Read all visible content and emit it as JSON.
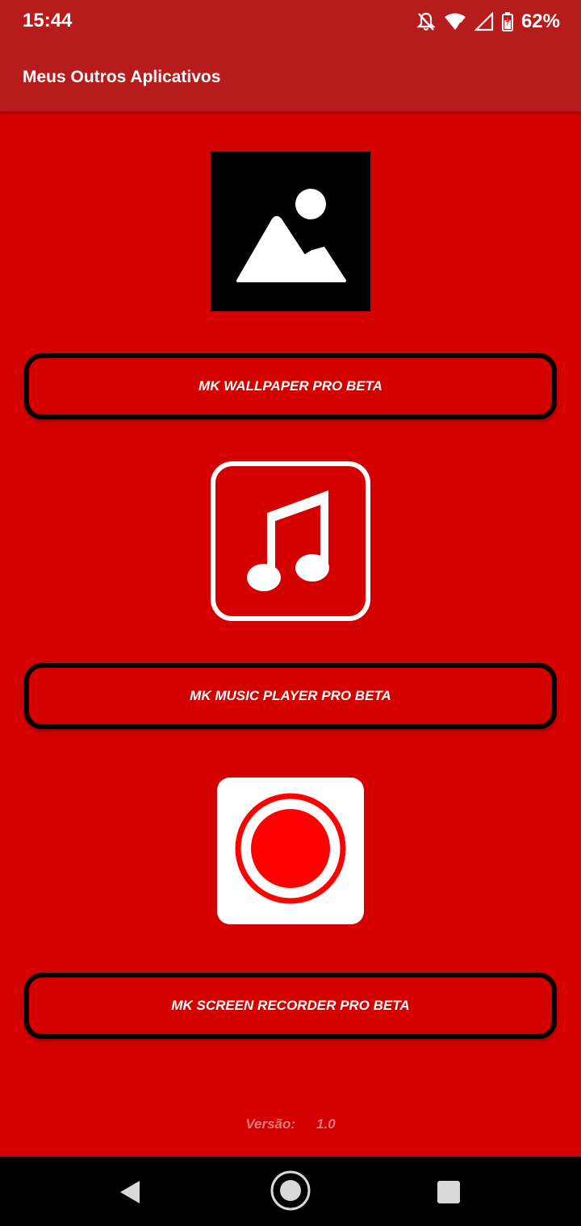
{
  "status_bar": {
    "time": "15:44",
    "battery": "62%",
    "icons": [
      "notifications-off-icon",
      "wifi-icon",
      "signal-icon",
      "battery-charging-icon"
    ]
  },
  "app_bar": {
    "title": "Meus Outros Aplicativos",
    "color": "#b71c1c"
  },
  "theme": {
    "background": "#d40000",
    "button_border": "#000000",
    "text": "#ffffff"
  },
  "apps": [
    {
      "icon": "image-placeholder-icon",
      "label": "MK WALLPAPER PRO BETA"
    },
    {
      "icon": "music-note-icon",
      "label": "MK MUSIC PLAYER PRO BETA"
    },
    {
      "icon": "record-icon",
      "label": "MK SCREEN RECORDER PRO BETA"
    }
  ],
  "footer": {
    "version_label": "Versão:",
    "version_number": "1.0"
  },
  "nav_bar": {
    "buttons": [
      "back-icon",
      "home-icon",
      "recents-icon"
    ]
  }
}
